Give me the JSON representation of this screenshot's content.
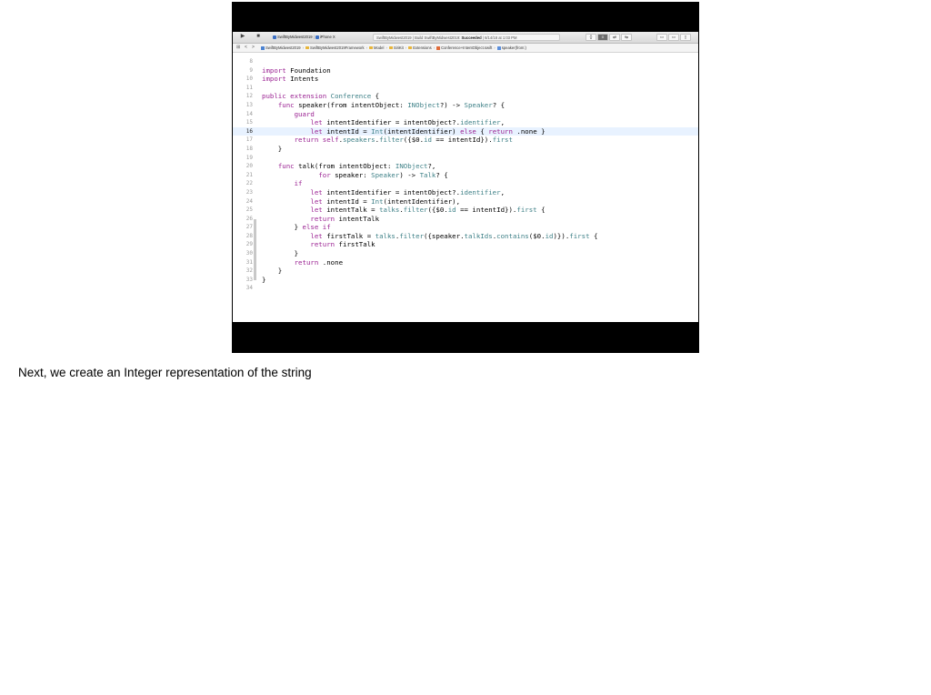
{
  "slide": {
    "caption": "Next, we create an Integer representation of the string"
  },
  "toolbar": {
    "run_icon": "▶",
    "stop_icon": "■",
    "scheme": "SwiftByMidwest2019",
    "device": "iPhone X",
    "status_project": "SwiftByMidwest2019",
    "status_action": "Build SwiftByMidwest2019:",
    "status_result": "Succeeded",
    "status_time": "6/14/18 at 1:03 PM",
    "right_controls": [
      "{}",
      "≡",
      "⇄",
      "⇆",
      "▭",
      "▭",
      "▯"
    ]
  },
  "jumpbar": {
    "nav_icons": [
      "⊞",
      "<",
      ">"
    ],
    "crumbs": [
      {
        "icon": "proj",
        "label": "SwiftByMidwest2019"
      },
      {
        "icon": "folder",
        "label": "SwiftByMidwest2019Framework"
      },
      {
        "icon": "folder",
        "label": "Model"
      },
      {
        "icon": "folder",
        "label": "SiriKit"
      },
      {
        "icon": "folder",
        "label": "Extensions"
      },
      {
        "icon": "swift",
        "label": "Conference+IntentObject.swift"
      },
      {
        "icon": "meth",
        "label": "speaker(from:)"
      }
    ]
  },
  "editor": {
    "current_line": "16",
    "lines": [
      {
        "n": "8",
        "segs": []
      },
      {
        "n": "9",
        "segs": [
          [
            "kw",
            "import"
          ],
          [
            "pl",
            " Foundation"
          ]
        ]
      },
      {
        "n": "10",
        "segs": [
          [
            "kw",
            "import"
          ],
          [
            "pl",
            " Intents"
          ]
        ]
      },
      {
        "n": "11",
        "segs": []
      },
      {
        "n": "12",
        "segs": [
          [
            "kw",
            "public extension"
          ],
          [
            "pl",
            " "
          ],
          [
            "ty",
            "Conference"
          ],
          [
            "pl",
            " {"
          ]
        ]
      },
      {
        "n": "13",
        "segs": [
          [
            "pl",
            "    "
          ],
          [
            "kw",
            "func"
          ],
          [
            "pl",
            " speaker(from intentObject: "
          ],
          [
            "ty",
            "INObject"
          ],
          [
            "pl",
            "?) -> "
          ],
          [
            "ty",
            "Speaker"
          ],
          [
            "pl",
            "? {"
          ]
        ]
      },
      {
        "n": "14",
        "segs": [
          [
            "pl",
            "        "
          ],
          [
            "kw",
            "guard"
          ]
        ]
      },
      {
        "n": "15",
        "segs": [
          [
            "pl",
            "            "
          ],
          [
            "kw",
            "let"
          ],
          [
            "pl",
            " intentIdentifier = intentObject?."
          ],
          [
            "pr",
            "identifier"
          ],
          [
            "pl",
            ","
          ]
        ]
      },
      {
        "n": "16",
        "segs": [
          [
            "pl",
            "            "
          ],
          [
            "kw",
            "let"
          ],
          [
            "pl",
            " intentId = "
          ],
          [
            "ty",
            "Int"
          ],
          [
            "pl",
            "(intentIdentifier) "
          ],
          [
            "kw",
            "else"
          ],
          [
            "pl",
            " { "
          ],
          [
            "kw",
            "return"
          ],
          [
            "pl",
            " ."
          ],
          [
            "pl",
            "none }"
          ]
        ]
      },
      {
        "n": "17",
        "segs": [
          [
            "pl",
            "        "
          ],
          [
            "kw",
            "return"
          ],
          [
            "pl",
            " "
          ],
          [
            "kw",
            "self"
          ],
          [
            "pl",
            "."
          ],
          [
            "pr",
            "speakers"
          ],
          [
            "pl",
            "."
          ],
          [
            "pr",
            "filter"
          ],
          [
            "pl",
            "({$0."
          ],
          [
            "pr",
            "id"
          ],
          [
            "pl",
            " == intentId})."
          ],
          [
            "pr",
            "first"
          ]
        ]
      },
      {
        "n": "18",
        "segs": [
          [
            "pl",
            "    }"
          ]
        ]
      },
      {
        "n": "19",
        "segs": []
      },
      {
        "n": "20",
        "segs": [
          [
            "pl",
            "    "
          ],
          [
            "kw",
            "func"
          ],
          [
            "pl",
            " talk(from intentObject: "
          ],
          [
            "ty",
            "INObject"
          ],
          [
            "pl",
            "?,"
          ]
        ]
      },
      {
        "n": "21",
        "segs": [
          [
            "pl",
            "              "
          ],
          [
            "kw",
            "for"
          ],
          [
            "pl",
            " speaker: "
          ],
          [
            "ty",
            "Speaker"
          ],
          [
            "pl",
            ") -> "
          ],
          [
            "ty",
            "Talk"
          ],
          [
            "pl",
            "? {"
          ]
        ]
      },
      {
        "n": "22",
        "segs": [
          [
            "pl",
            "        "
          ],
          [
            "kw",
            "if"
          ]
        ]
      },
      {
        "n": "23",
        "segs": [
          [
            "pl",
            "            "
          ],
          [
            "kw",
            "let"
          ],
          [
            "pl",
            " intentIdentifier = intentObject?."
          ],
          [
            "pr",
            "identifier"
          ],
          [
            "pl",
            ","
          ]
        ]
      },
      {
        "n": "24",
        "segs": [
          [
            "pl",
            "            "
          ],
          [
            "kw",
            "let"
          ],
          [
            "pl",
            " intentId = "
          ],
          [
            "ty",
            "Int"
          ],
          [
            "pl",
            "(intentIdentifier),"
          ]
        ]
      },
      {
        "n": "25",
        "segs": [
          [
            "pl",
            "            "
          ],
          [
            "kw",
            "let"
          ],
          [
            "pl",
            " intentTalk = "
          ],
          [
            "pr",
            "talks"
          ],
          [
            "pl",
            "."
          ],
          [
            "pr",
            "filter"
          ],
          [
            "pl",
            "({$0."
          ],
          [
            "pr",
            "id"
          ],
          [
            "pl",
            " == intentId})."
          ],
          [
            "pr",
            "first"
          ],
          [
            "pl",
            " {"
          ]
        ]
      },
      {
        "n": "26",
        "segs": [
          [
            "pl",
            "            "
          ],
          [
            "kw",
            "return"
          ],
          [
            "pl",
            " intentTalk"
          ]
        ]
      },
      {
        "n": "27",
        "segs": [
          [
            "pl",
            "        } "
          ],
          [
            "kw",
            "else if"
          ]
        ]
      },
      {
        "n": "28",
        "segs": [
          [
            "pl",
            "            "
          ],
          [
            "kw",
            "let"
          ],
          [
            "pl",
            " firstTalk = "
          ],
          [
            "pr",
            "talks"
          ],
          [
            "pl",
            "."
          ],
          [
            "pr",
            "filter"
          ],
          [
            "pl",
            "({speaker."
          ],
          [
            "pr",
            "talkIds"
          ],
          [
            "pl",
            "."
          ],
          [
            "pr",
            "contains"
          ],
          [
            "pl",
            "($0."
          ],
          [
            "pr",
            "id"
          ],
          [
            "pl",
            ")})."
          ],
          [
            "pr",
            "first"
          ],
          [
            "pl",
            " {"
          ]
        ]
      },
      {
        "n": "29",
        "segs": [
          [
            "pl",
            "            "
          ],
          [
            "kw",
            "return"
          ],
          [
            "pl",
            " firstTalk"
          ]
        ]
      },
      {
        "n": "30",
        "segs": [
          [
            "pl",
            "        }"
          ]
        ]
      },
      {
        "n": "31",
        "segs": [
          [
            "pl",
            "        "
          ],
          [
            "kw",
            "return"
          ],
          [
            "pl",
            " ."
          ],
          [
            "pl",
            "none"
          ]
        ]
      },
      {
        "n": "32",
        "segs": [
          [
            "pl",
            "    }"
          ]
        ]
      },
      {
        "n": "33",
        "segs": [
          [
            "pl",
            "}"
          ]
        ]
      },
      {
        "n": "34",
        "segs": []
      }
    ]
  }
}
